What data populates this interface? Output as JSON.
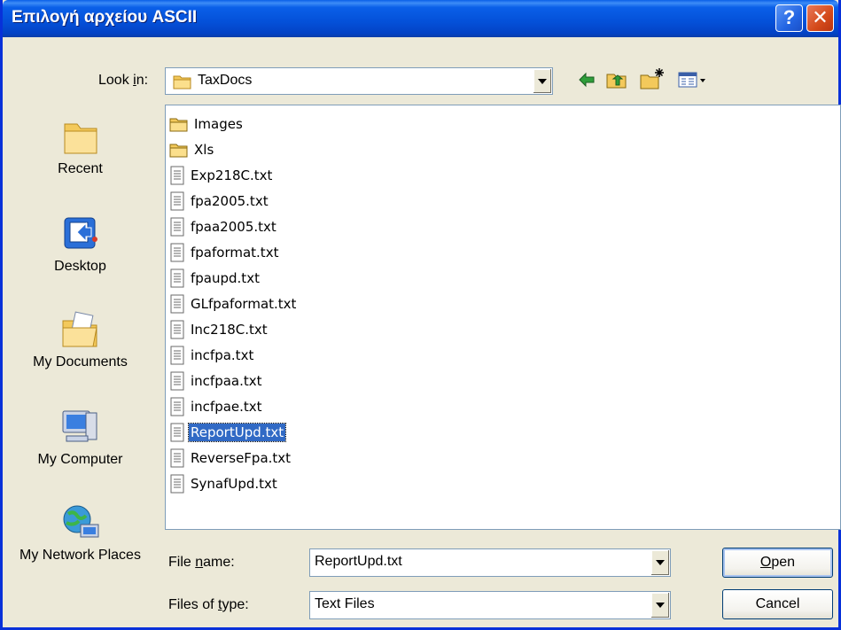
{
  "window": {
    "title": "Επιλογή αρχείου ASCII",
    "help_label": "?",
    "close_label": "✕"
  },
  "lookin": {
    "label_pre": "Look ",
    "label_accel": "i",
    "label_post": "n:",
    "value": "TaxDocs",
    "toolbar_icons": [
      "back-arrow-icon",
      "up-folder-icon",
      "new-folder-icon",
      "view-menu-icon"
    ]
  },
  "places": [
    {
      "label": "Recent",
      "icon": "recent-folder-icon"
    },
    {
      "label": "Desktop",
      "icon": "desktop-icon"
    },
    {
      "label": "My Documents",
      "icon": "my-documents-icon"
    },
    {
      "label": "My Computer",
      "icon": "my-computer-icon"
    },
    {
      "label": "My Network Places",
      "icon": "network-places-icon"
    }
  ],
  "files": [
    {
      "name": "Images",
      "type": "folder"
    },
    {
      "name": "Xls",
      "type": "folder"
    },
    {
      "name": "Exp218C.txt",
      "type": "text"
    },
    {
      "name": "fpa2005.txt",
      "type": "text"
    },
    {
      "name": "fpaa2005.txt",
      "type": "text"
    },
    {
      "name": "fpaformat.txt",
      "type": "text"
    },
    {
      "name": "fpaupd.txt",
      "type": "text"
    },
    {
      "name": "GLfpaformat.txt",
      "type": "text"
    },
    {
      "name": "Inc218C.txt",
      "type": "text"
    },
    {
      "name": "incfpa.txt",
      "type": "text"
    },
    {
      "name": "incfpaa.txt",
      "type": "text"
    },
    {
      "name": "incfpae.txt",
      "type": "text"
    },
    {
      "name": "ReportUpd.txt",
      "type": "text",
      "selected": true
    },
    {
      "name": "ReverseFpa.txt",
      "type": "text"
    },
    {
      "name": "SynafUpd.txt",
      "type": "text"
    }
  ],
  "filename": {
    "label_pre": "File ",
    "label_accel": "n",
    "label_post": "ame:",
    "value": "ReportUpd.txt"
  },
  "filetype": {
    "label_pre": "Files of ",
    "label_accel": "t",
    "label_post": "ype:",
    "value": "Text Files"
  },
  "buttons": {
    "open_accel": "O",
    "open_rest": "pen",
    "cancel": "Cancel"
  },
  "colors": {
    "titlebar": "#0a5fe8",
    "selection": "#316ac5",
    "face": "#ece9d8"
  }
}
